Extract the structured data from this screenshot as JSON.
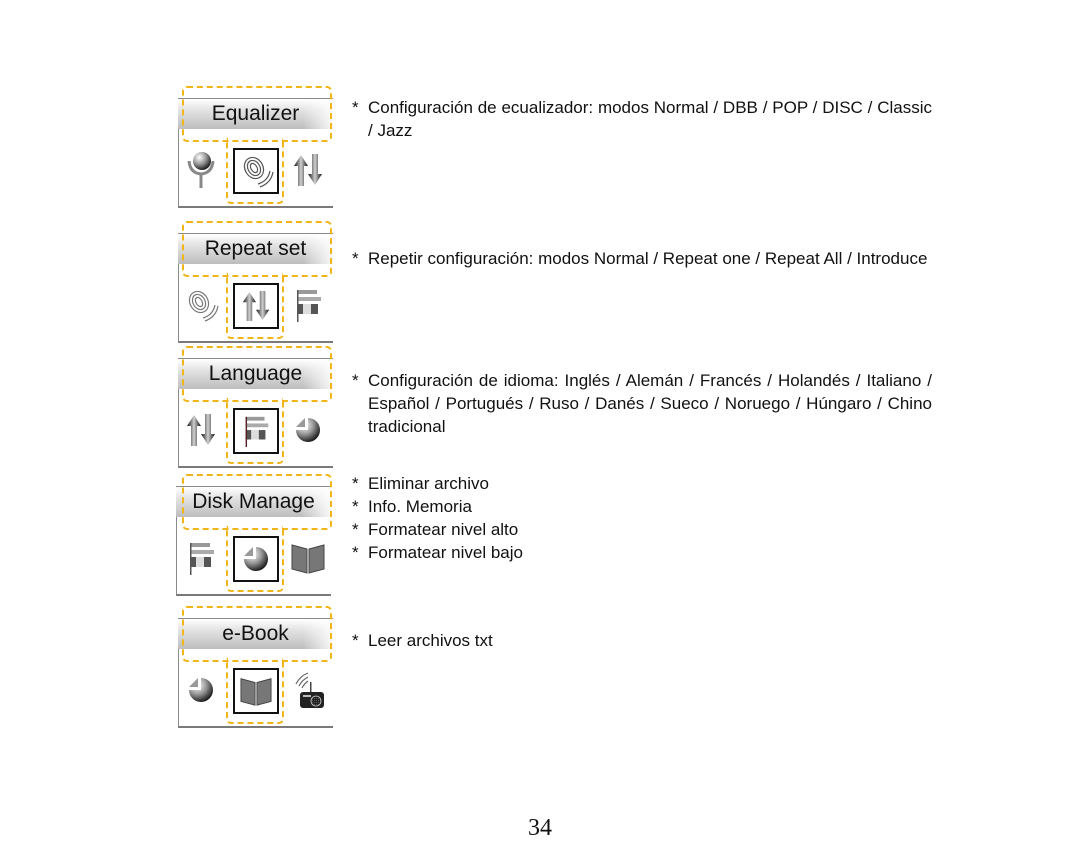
{
  "menu_panels": [
    {
      "title": "Equalizer",
      "left_icon": "microphone-icon",
      "selected_icon": "equalizer-sound-icon",
      "right_icon": "repeat-arrows-icon",
      "description": [
        "Configuración de ecualizador: modos Normal / DBB / POP / DISC / Classic / Jazz"
      ]
    },
    {
      "title": "Repeat set",
      "left_icon": "equalizer-sound-icon",
      "selected_icon": "repeat-arrows-icon",
      "right_icon": "language-flag-icon",
      "description": [
        "Repetir configuración: modos Normal / Repeat one / Repeat All / Introduce"
      ]
    },
    {
      "title": "Language",
      "left_icon": "repeat-arrows-icon",
      "selected_icon": "language-flag-icon",
      "right_icon": "disk-pie-icon",
      "description": [
        "Configuración de idioma: Inglés / Alemán / Francés / Holandés / Italiano / Español / Portugués / Ruso / Danés / Sueco / Noruego / Húngaro / Chino tradicional"
      ]
    },
    {
      "title": "Disk Manage",
      "left_icon": "language-flag-icon",
      "selected_icon": "disk-pie-icon",
      "right_icon": "ebook-icon",
      "description": [
        "Eliminar archivo",
        "Info. Memoria",
        "Formatear nivel alto",
        "Formatear nivel bajo"
      ]
    },
    {
      "title": "e-Book",
      "left_icon": "disk-pie-icon",
      "selected_icon": "ebook-icon",
      "right_icon": "radio-icon",
      "description": [
        "Leer archivos txt"
      ]
    }
  ],
  "bullet": "*",
  "page_number": "34",
  "colors": {
    "dash": "#f2b519",
    "text": "#111111"
  }
}
